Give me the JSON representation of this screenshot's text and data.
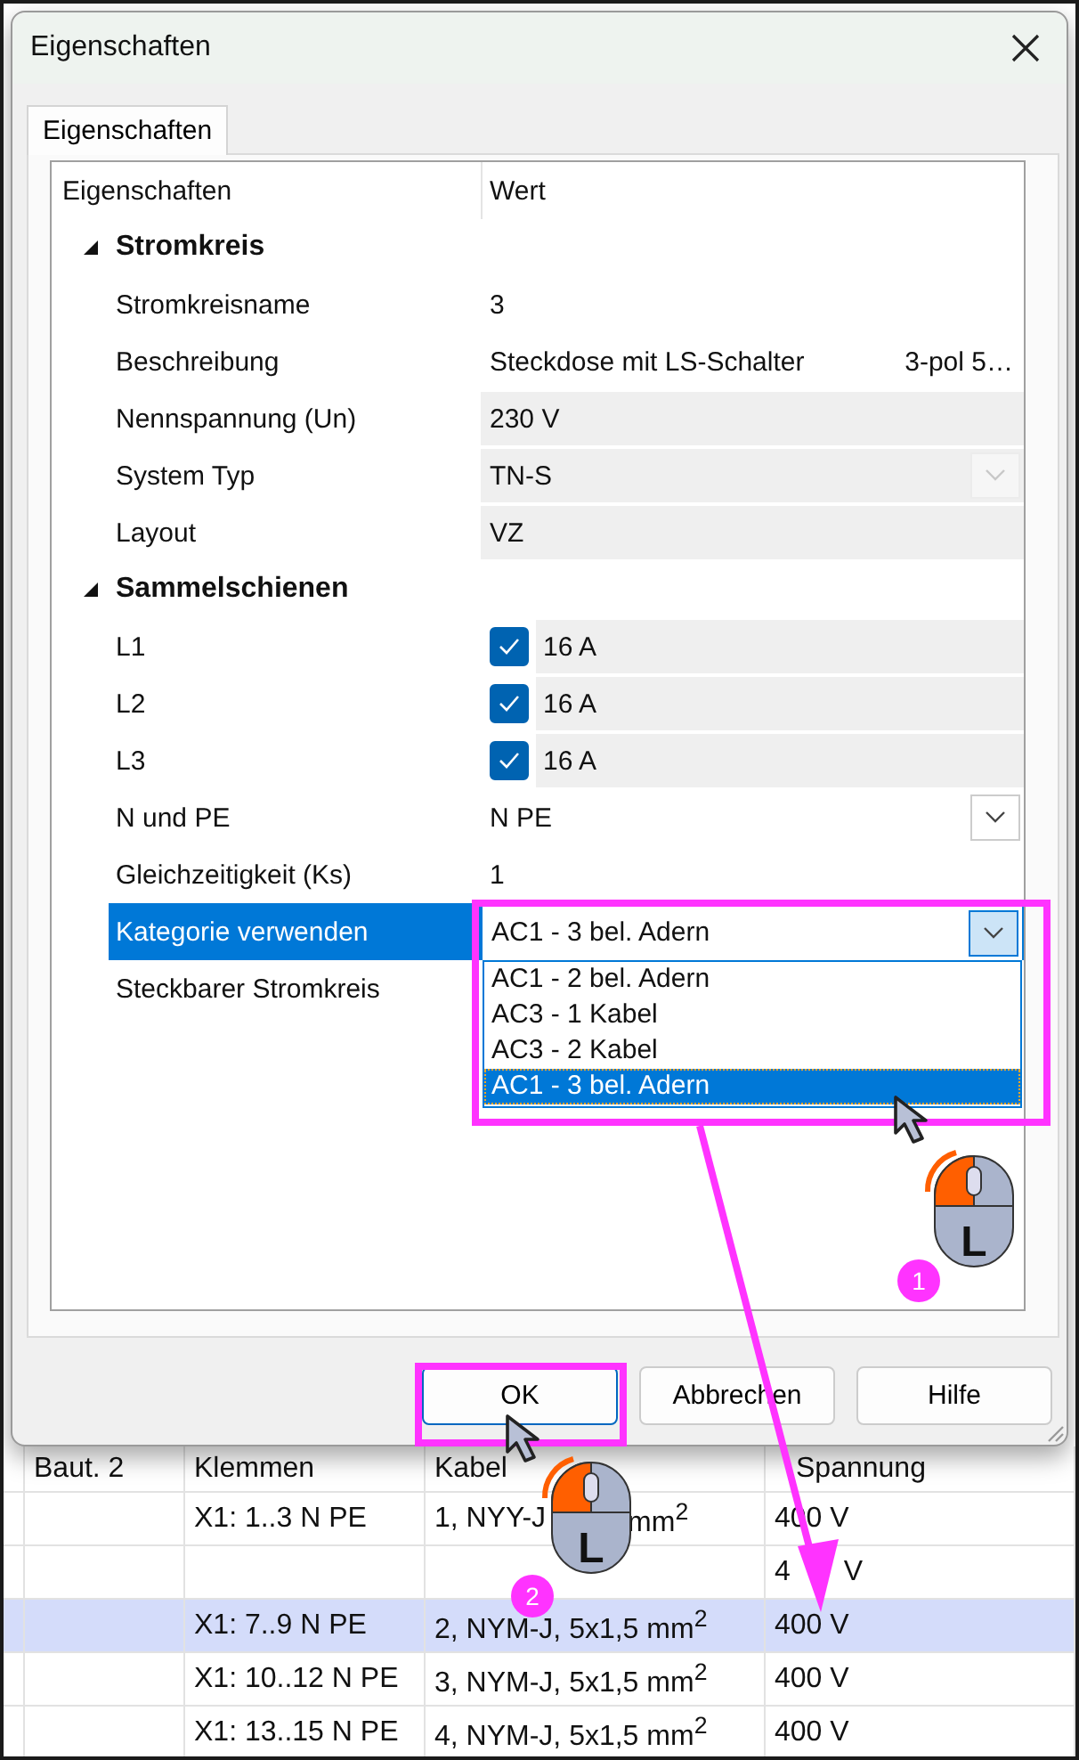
{
  "dialog": {
    "title": "Eigenschaften",
    "tabs": [
      {
        "label": "Eigenschaften",
        "selected": true
      }
    ],
    "grid": {
      "columns": [
        "Eigenschaften",
        "Wert"
      ],
      "groups": [
        {
          "label": "Stromkreis",
          "expanded": true,
          "children": [
            {
              "kind": "text",
              "label": "Stromkreisname",
              "value": "3",
              "selected": false
            },
            {
              "kind": "text",
              "label": "Beschreibung",
              "value": "Steckdose mit LS-Schalter",
              "note": "3-pol 5…",
              "selected": false
            },
            {
              "kind": "readonly",
              "label": "Nennspannung (Un)",
              "value": "230 V",
              "selected": false
            },
            {
              "kind": "combo",
              "label": "System Typ",
              "value": "TN-S",
              "disabled": true,
              "selected": false
            },
            {
              "kind": "readonly",
              "label": "Layout",
              "value": "VZ",
              "selected": false
            }
          ]
        },
        {
          "label": "Sammelschienen",
          "expanded": true,
          "children": [
            {
              "kind": "checkbox",
              "label": "L1",
              "value": "16 A",
              "checked": true,
              "selected": false
            },
            {
              "kind": "checkbox",
              "label": "L2",
              "value": "16 A",
              "checked": true,
              "selected": false
            },
            {
              "kind": "checkbox",
              "label": "L3",
              "value": "16 A",
              "checked": true,
              "selected": false
            },
            {
              "kind": "combo",
              "label": "N und PE",
              "value": "N PE",
              "disabled": false,
              "selected": false
            },
            {
              "kind": "text",
              "label": "Gleichzeitigkeit (Ks)",
              "value": "1",
              "selected": false
            },
            {
              "kind": "combo",
              "label": "Kategorie verwenden",
              "value": "AC1 - 3 bel. Adern",
              "disabled": false,
              "open": true,
              "selected": true,
              "options": [
                {
                  "label": "AC1 - 2 bel. Adern",
                  "selected": false
                },
                {
                  "label": "AC3 - 1 Kabel",
                  "selected": false
                },
                {
                  "label": "AC3 - 2 Kabel",
                  "selected": false
                },
                {
                  "label": "AC1 - 3 bel. Adern",
                  "selected": true
                }
              ]
            },
            {
              "kind": "text",
              "label": "Steckbarer Stromkreis",
              "selected": false
            }
          ]
        }
      ]
    },
    "buttons": [
      {
        "label": "OK",
        "default": true
      },
      {
        "label": "Abbrechen",
        "default": false
      },
      {
        "label": "Hilfe",
        "default": false
      }
    ]
  },
  "table": {
    "columns": [
      "Baut. 2",
      "Klemmen",
      "Kabel",
      "Spannung"
    ],
    "rows": [
      {
        "cells": [
          "",
          "X1: 1..3 N PE",
          [
            "1, NYY-J",
            "mm$^{2}$"
          ],
          "400 V"
        ],
        "selected": false
      },
      {
        "cells": [
          "",
          "",
          "",
          [
            "4",
            "V"
          ]
        ],
        "selected": false
      },
      {
        "cells": [
          "",
          "X1: 7..9 N PE",
          "2, NYM-J, 5x1,5 mm$^{2}$",
          "400 V"
        ],
        "selected": true
      },
      {
        "cells": [
          "",
          "X1: 10..12 N PE",
          "3, NYM-J, 5x1,5 mm$^{2}$",
          "400 V"
        ],
        "selected": false
      },
      {
        "cells": [
          "",
          "X1: 13..15 N PE",
          "4, NYM-J, 5x1,5 mm$^{2}$",
          "400 V"
        ],
        "selected": false
      }
    ]
  },
  "annotations": {
    "steps": [
      {
        "number": "1",
        "button": "L"
      },
      {
        "number": "2",
        "button": "L"
      }
    ]
  }
}
